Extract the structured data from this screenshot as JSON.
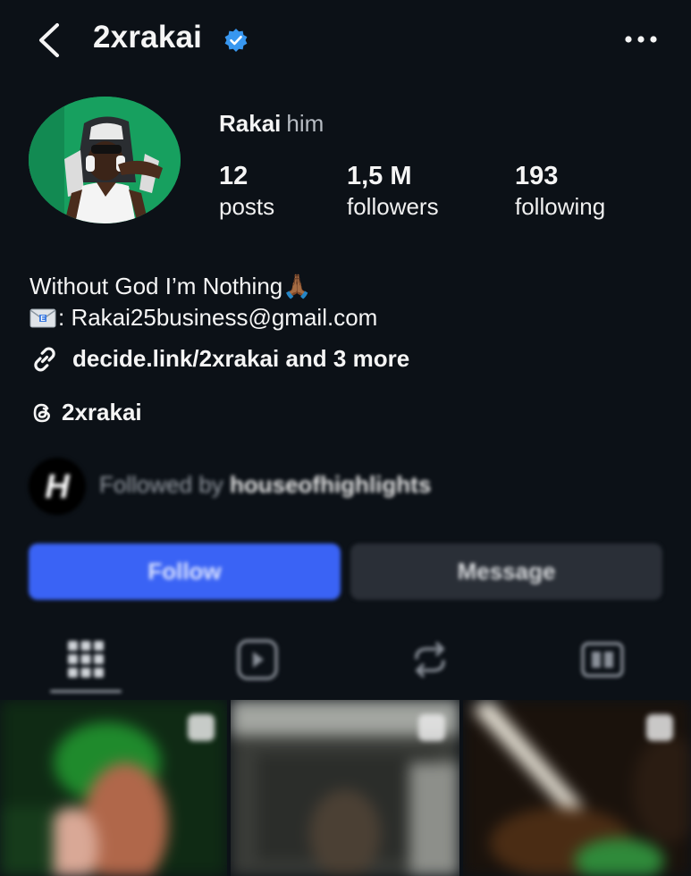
{
  "header": {
    "username": "2xrakai",
    "verified_icon": "verified-badge-icon",
    "back_icon": "chevron-left-icon",
    "more_icon": "more-horizontal-icon"
  },
  "profile": {
    "name": "Rakai",
    "pronouns": "him",
    "stats": [
      {
        "value": "12",
        "label": "posts"
      },
      {
        "value": "1,5 M",
        "label": "followers"
      },
      {
        "value": "193",
        "label": "following"
      }
    ],
    "bio_line1": "Without God I’m Nothing🙏🏾",
    "bio_email": ": Rakai25business@gmail.com",
    "link_text": "decide.link/2xrakai and 3 more",
    "threads_handle": "2xrakai"
  },
  "followed_by": {
    "prefix": "Followed by ",
    "account": "houseofhighlights",
    "avatar_letter": "H"
  },
  "actions": {
    "follow_label": "Follow",
    "message_label": "Message"
  },
  "tabs": [
    "grid-icon",
    "reels-icon",
    "reposts-icon",
    "tagged-icon"
  ],
  "colors": {
    "background": "#0c1117",
    "follow_button": "#3a63f5",
    "message_button": "#2a2f37",
    "verified": "#3897f0"
  }
}
